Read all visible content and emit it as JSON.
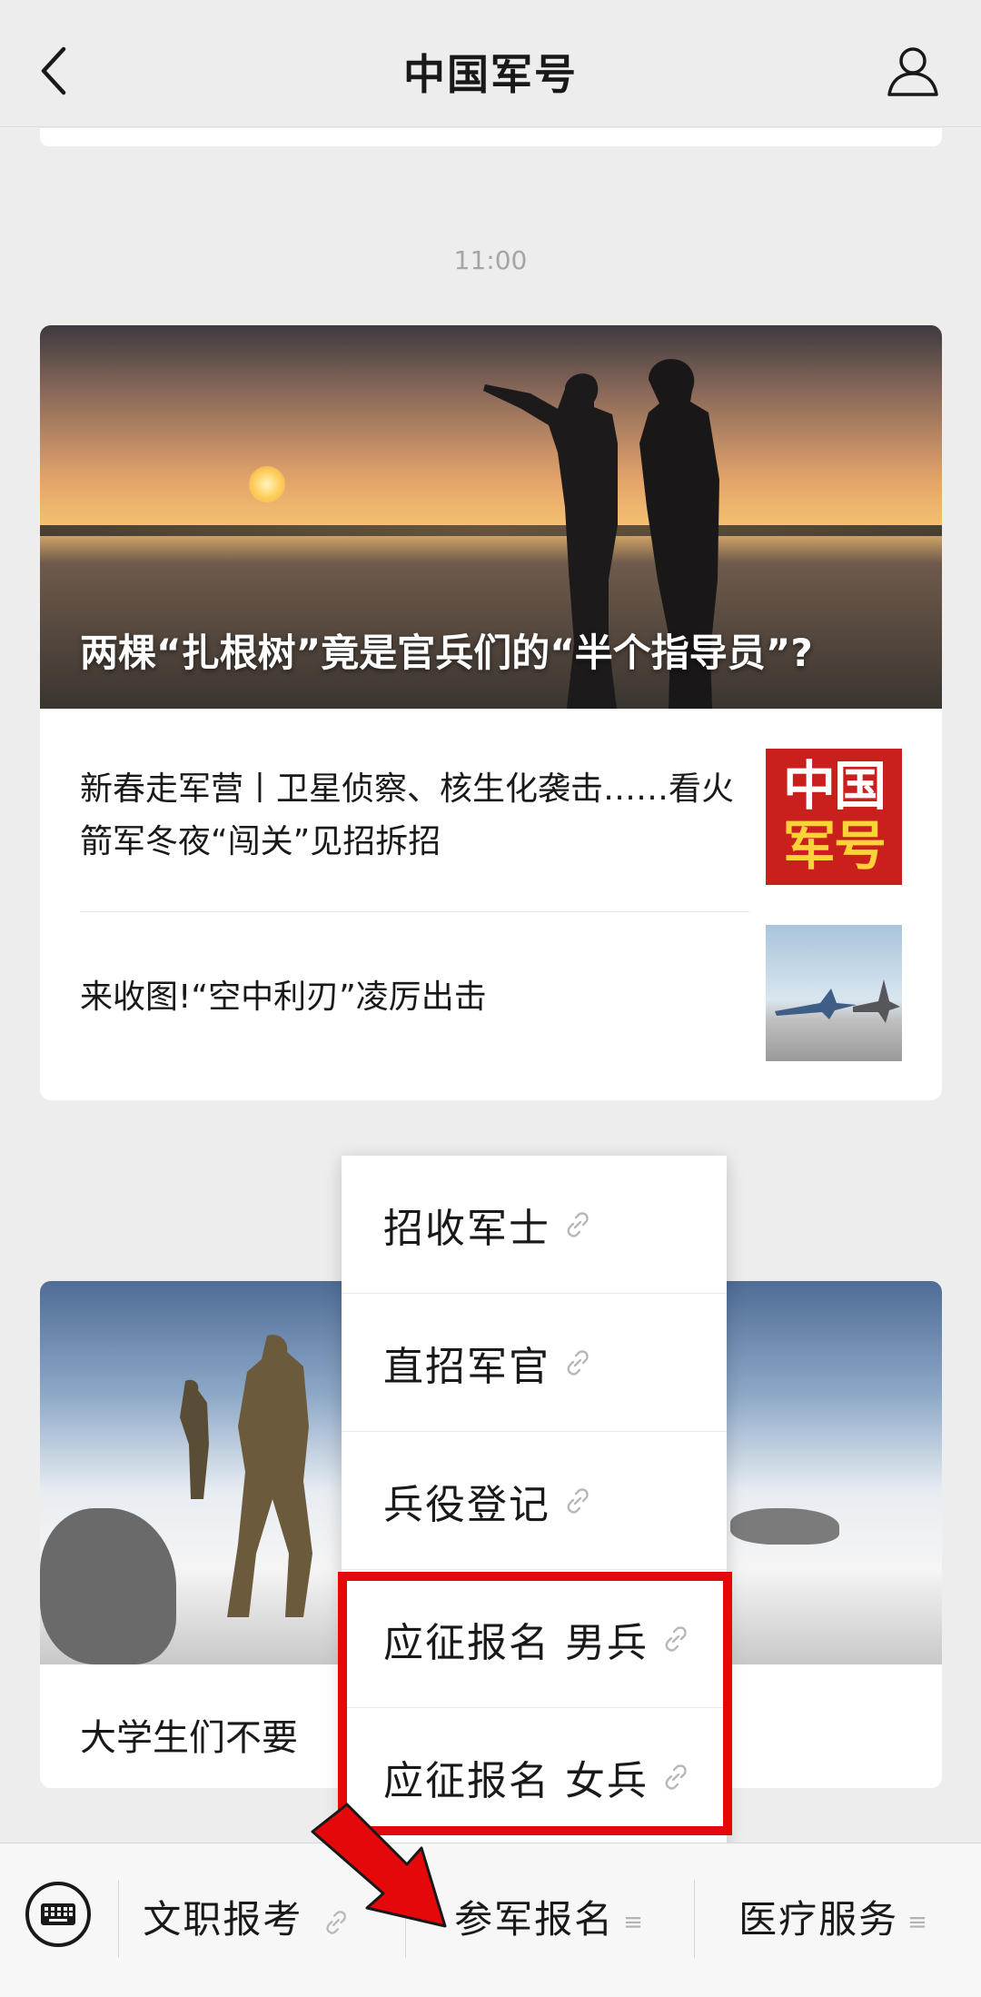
{
  "header": {
    "title": "中国军号",
    "back_icon": "back-icon",
    "profile_icon": "profile-icon"
  },
  "timestamp": "11:00",
  "article_card_1": {
    "hero_title": "两棵“扎根树”竟是官兵们的“半个指导员”?",
    "items": [
      {
        "text": "新春走军营丨卫星侦察、核生化袭击……看火箭军冬夜“闯关”见招拆招",
        "thumb_text_line1": "中国",
        "thumb_text_line2": "军号"
      },
      {
        "text": "来收图!“空中利刃”凌厉出击"
      }
    ]
  },
  "article_card_2": {
    "visible_text": "大学生们不要"
  },
  "menu": {
    "items": [
      {
        "label": "招收军士"
      },
      {
        "label": "直招军官"
      },
      {
        "label": "兵役登记"
      },
      {
        "label": "应征报名 男兵"
      },
      {
        "label": "应征报名 女兵"
      }
    ],
    "highlight_color": "#e4080a"
  },
  "bottom_bar": {
    "keyboard_icon": "keyboard-icon",
    "tabs": [
      {
        "label": "文职报考"
      },
      {
        "label": "参军报名",
        "suffix": "≡"
      },
      {
        "label": "医疗服务",
        "suffix": "≡"
      }
    ]
  },
  "colors": {
    "background": "#ededed",
    "highlight": "#e4080a",
    "thumb_red": "#c9201d",
    "thumb_yellow": "#ffd23a"
  }
}
